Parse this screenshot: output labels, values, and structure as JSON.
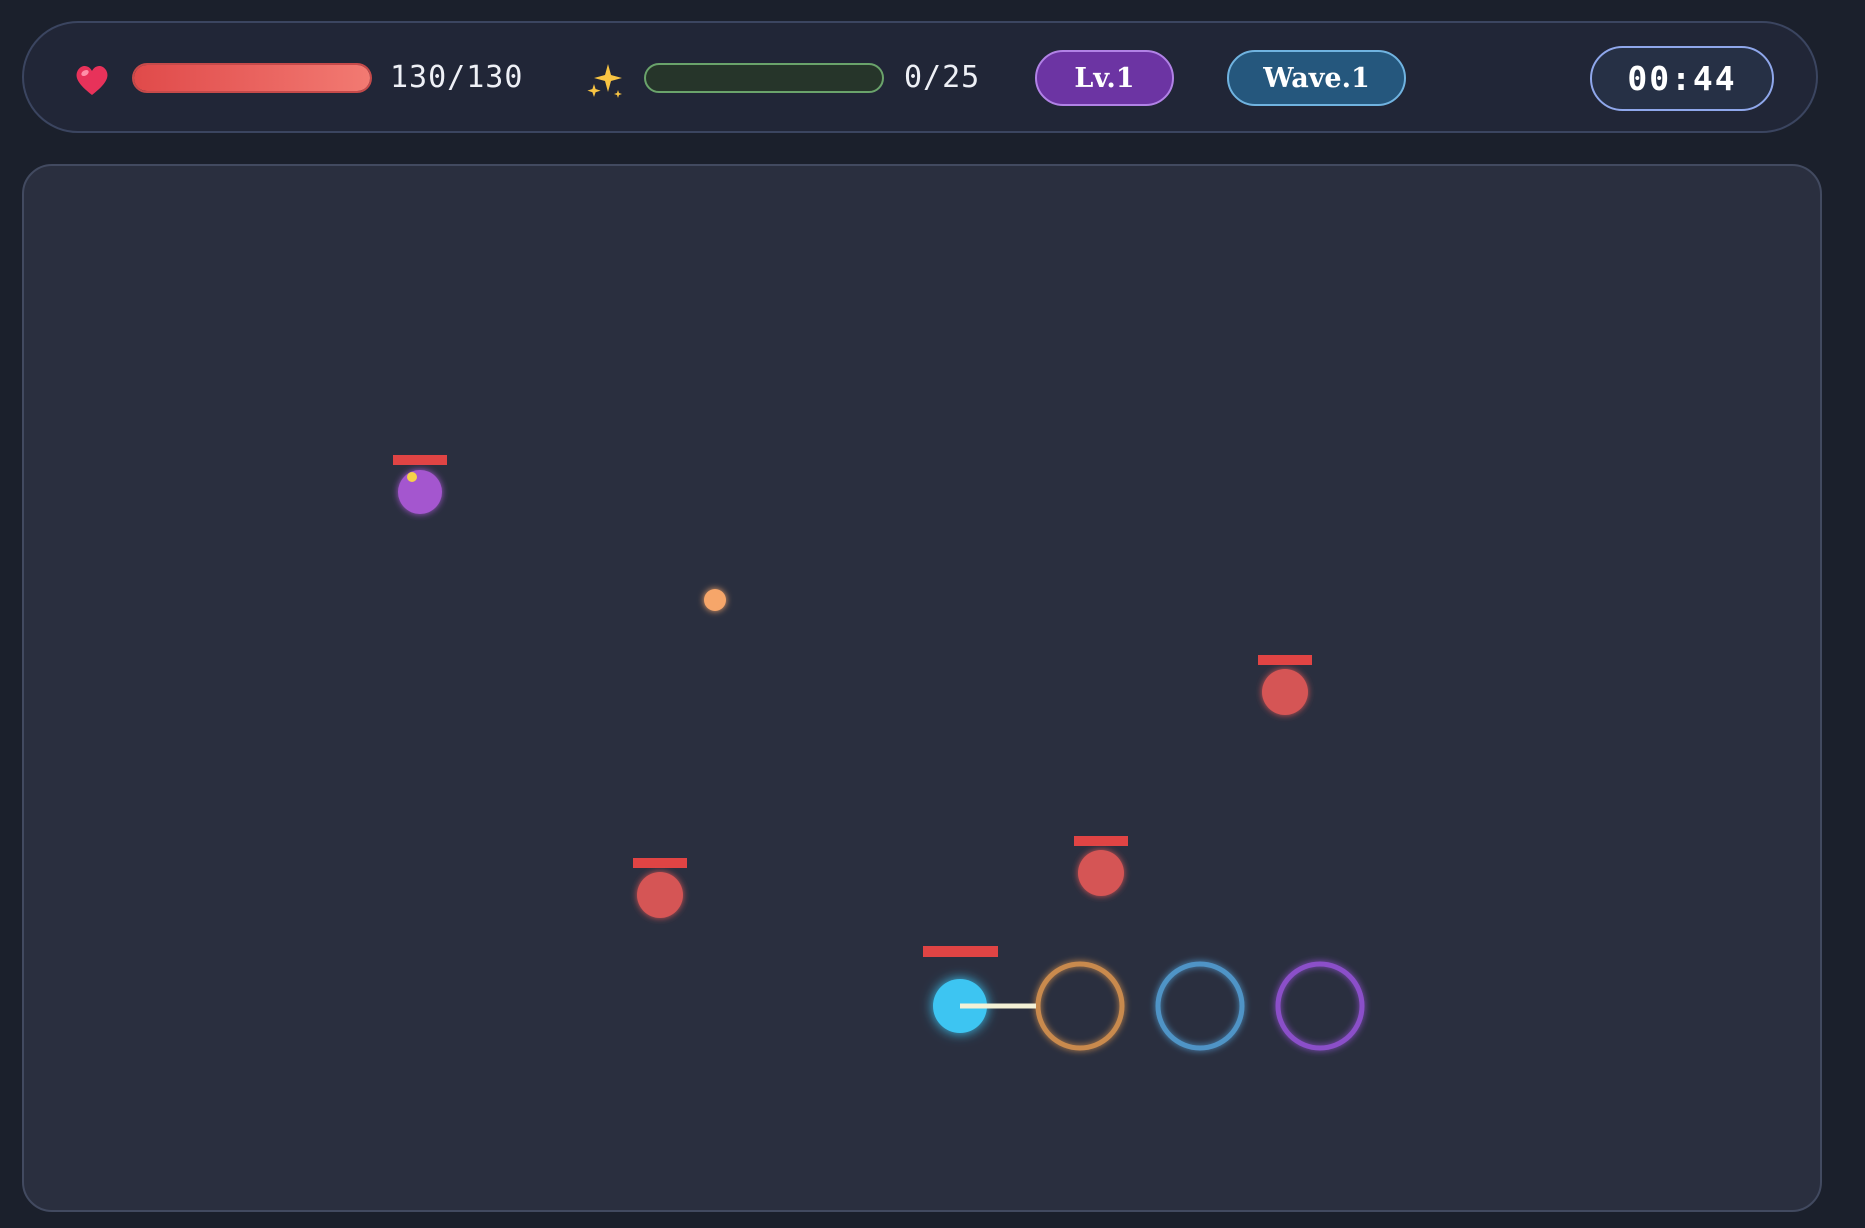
{
  "hud": {
    "health": {
      "icon": "heart-icon",
      "current": 130,
      "max": 130,
      "text": "130/130",
      "fill_fraction": 1.0,
      "color": "#e85555"
    },
    "experience": {
      "icon": "sparkle-icon",
      "current": 0,
      "max": 25,
      "text": "0/25",
      "fill_fraction": 0.0,
      "color": "#6cc070"
    },
    "level_label": "Lv.1",
    "wave_label": "Wave.1",
    "timer": "00:44"
  },
  "colors": {
    "hud_background": "#212637",
    "arena_background": "#2a2f3f",
    "player": "#3ec5f2",
    "enemy": "#d55454",
    "elite_enemy": "#a457cf",
    "enemy_health_bar": "#e04444",
    "xp_orb": "#f6a66a",
    "orbit_ring_orange": "#c98a4e",
    "orbit_ring_blue": "#4f94c6",
    "orbit_ring_purple": "#8b4fc9"
  },
  "entities": {
    "player": {
      "name": "player",
      "health_fraction": 1.0
    },
    "enemies": [
      {
        "name": "enemy-elite",
        "kind": "elite",
        "health_fraction": 1.0
      },
      {
        "name": "enemy",
        "kind": "basic",
        "health_fraction": 1.0
      },
      {
        "name": "enemy",
        "kind": "basic",
        "health_fraction": 1.0
      },
      {
        "name": "enemy",
        "kind": "basic",
        "health_fraction": 1.0
      }
    ],
    "xp_orbs": 1,
    "orbit_rings": [
      "orange",
      "blue",
      "purple"
    ]
  }
}
